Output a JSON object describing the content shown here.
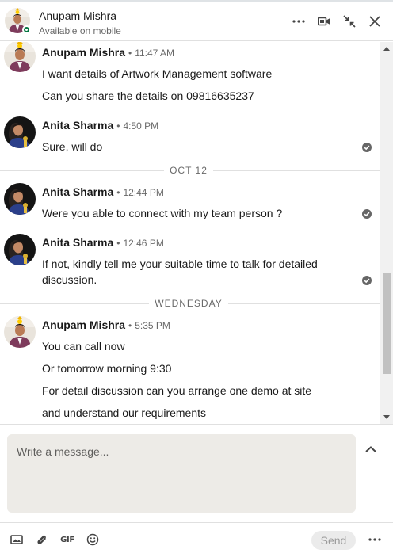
{
  "header": {
    "name": "Anupam Mishra",
    "status": "Available on mobile",
    "icons": [
      "more-icon",
      "video-call-icon",
      "minimize-icon",
      "close-icon"
    ]
  },
  "messages": {
    "dividers": [
      "OCT 12",
      "WEDNESDAY"
    ],
    "groups": [
      {
        "sender": "Anupam Mishra",
        "time": "11:47 AM",
        "lines": [
          "I want details of Artwork Management software",
          "Can you share the details on 09816635237"
        ]
      },
      {
        "sender": "Anita Sharma",
        "time": "4:50 PM",
        "lines": [
          "Sure, will do"
        ]
      },
      {
        "sender": "Anita Sharma",
        "time": "12:44 PM",
        "lines": [
          "Were you able to connect with my team person ?"
        ]
      },
      {
        "sender": "Anita Sharma",
        "time": "12:46 PM",
        "lines": [
          "If not, kindly tell me your suitable time to talk for detailed discussion."
        ]
      },
      {
        "sender": "Anupam Mishra",
        "time": "5:35 PM",
        "lines": [
          "You can call now",
          "Or tomorrow morning 9:30",
          "For detail discussion can you arrange one demo at site",
          "and understand our requirements"
        ]
      }
    ]
  },
  "compose": {
    "placeholder": "Write a message...",
    "value": ""
  },
  "footer": {
    "gif_label": "GIF",
    "send_label": "Send",
    "icons": [
      "image-icon",
      "attachment-icon",
      "gif-icon",
      "emoji-icon",
      "more-options-icon"
    ]
  },
  "colors": {
    "presence": "#057642",
    "compose_bg": "#edebe7",
    "send_bg": "#ebebeb",
    "seen_check": "#666666"
  }
}
